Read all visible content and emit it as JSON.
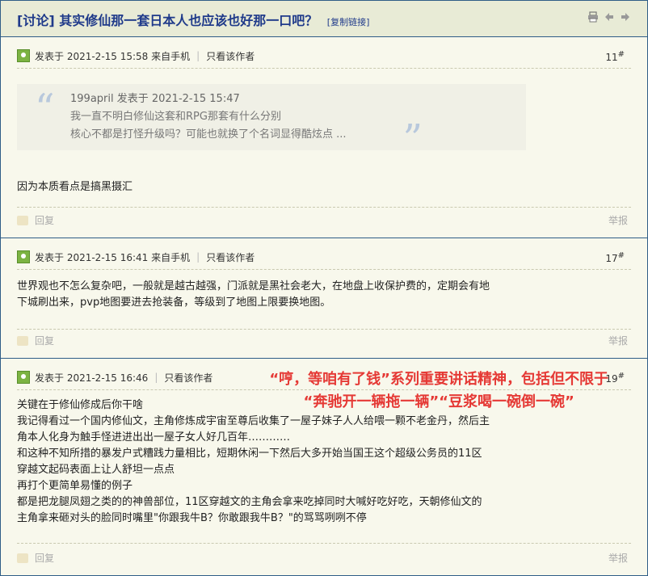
{
  "thread": {
    "title": "[讨论] 其实修仙那一套日本人也应该也好那一口吧？",
    "copy_link": "[复制链接]"
  },
  "posts": [
    {
      "meta": "发表于 2021-2-15 15:58 来自手机",
      "only_author": "只看该作者",
      "floor": "11",
      "floor_mark": "#",
      "quote": {
        "author_line": "199april 发表于 2021-2-15 15:47",
        "lines": [
          "我一直不明白修仙这套和RPG那套有什么分别",
          "核心不都是打怪升级吗？可能也就换了个名词显得酷炫点 ..."
        ]
      },
      "body": [
        "因为本质看点是搞黑摄汇"
      ],
      "reply": "回复",
      "report": "举报"
    },
    {
      "meta": "发表于 2021-2-15 16:41 来自手机",
      "only_author": "只看该作者",
      "floor": "17",
      "floor_mark": "#",
      "body": [
        "世界观也不怎么复杂吧，一般就是越古越强，门派就是黑社会老大，在地盘上收保护费的，定期会有地",
        "下城刷出来，pvp地图要进去抢装备，等级到了地图上限要换地图。"
      ],
      "reply": "回复",
      "report": "举报"
    },
    {
      "meta": "发表于 2021-2-15 16:46",
      "only_author": "只看该作者",
      "floor": "19",
      "floor_mark": "#",
      "body": [
        "关键在于修仙修成后你干啥",
        "我记得看过一个国内修仙文，主角修炼成宇宙至尊后收集了一屋子妹子人人给喂一颗不老金丹，然后主",
        "角本人化身为触手怪进进出出一屋子女人好几百年…………",
        "和这种不知所措的暴发户式糟践力量相比，短期休闲一下然后大多开始当国王这个超级公务员的11区",
        "穿越文起码表面上让人舒坦一点点",
        "再打个更简单易懂的例子",
        "都是把龙腿凤翅之类的的神兽部位，11区穿越文的主角会拿来吃掉同时大喊好吃好吃，天朝修仙文的",
        "主角拿来砸对头的脸同时嘴里\"你跟我牛B？你敢跟我牛B？\"的骂骂咧咧不停"
      ],
      "reply": "回复",
      "report": "举报"
    }
  ],
  "annotation": {
    "line1": "“哼，等咱有了钱”系列重要讲话精神，包括但不限于",
    "line2": "“奔驰开一辆拖一辆”“豆浆喝一碗倒一碗”"
  },
  "colors": {
    "accent": "#1f3a8a",
    "border": "#2f5d87",
    "annotation": "#e53935",
    "background": "#f8f8ec"
  },
  "icons": [
    "print-icon",
    "prev-thread-icon",
    "next-thread-icon",
    "user-avatar-icon",
    "reply-icon"
  ]
}
